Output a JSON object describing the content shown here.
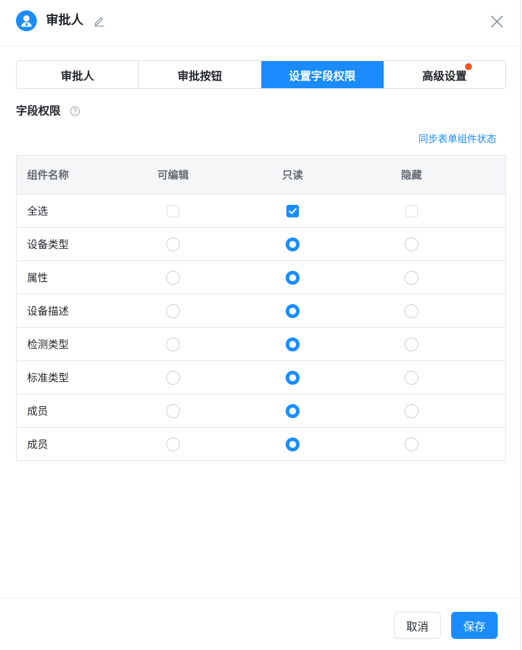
{
  "header": {
    "title": "审批人",
    "avatar_icon": "user-icon",
    "edit_icon": "pencil-icon",
    "close_icon": "close-icon"
  },
  "tabs": [
    {
      "label": "审批人",
      "active": false
    },
    {
      "label": "审批按钮",
      "active": false
    },
    {
      "label": "设置字段权限",
      "active": true
    },
    {
      "label": "高级设置",
      "active": false,
      "badge": true
    }
  ],
  "section": {
    "title": "字段权限",
    "help_icon": "question-circle-icon",
    "sync_link": "同步表单组件状态"
  },
  "table": {
    "headers": [
      "组件名称",
      "可编辑",
      "只读",
      "隐藏"
    ],
    "select_all": {
      "label": "全选",
      "editable": false,
      "readonly": true,
      "hidden": false
    },
    "rows": [
      {
        "name": "设备类型",
        "permission": "readonly"
      },
      {
        "name": "属性",
        "permission": "readonly"
      },
      {
        "name": "设备描述",
        "permission": "readonly"
      },
      {
        "name": "检测类型",
        "permission": "readonly"
      },
      {
        "name": "标准类型",
        "permission": "readonly"
      },
      {
        "name": "成员",
        "permission": "readonly"
      },
      {
        "name": "成员",
        "permission": "readonly"
      }
    ]
  },
  "footer": {
    "cancel_label": "取消",
    "save_label": "保存"
  },
  "colors": {
    "accent": "#1a8cff",
    "badge": "#f5541f"
  }
}
